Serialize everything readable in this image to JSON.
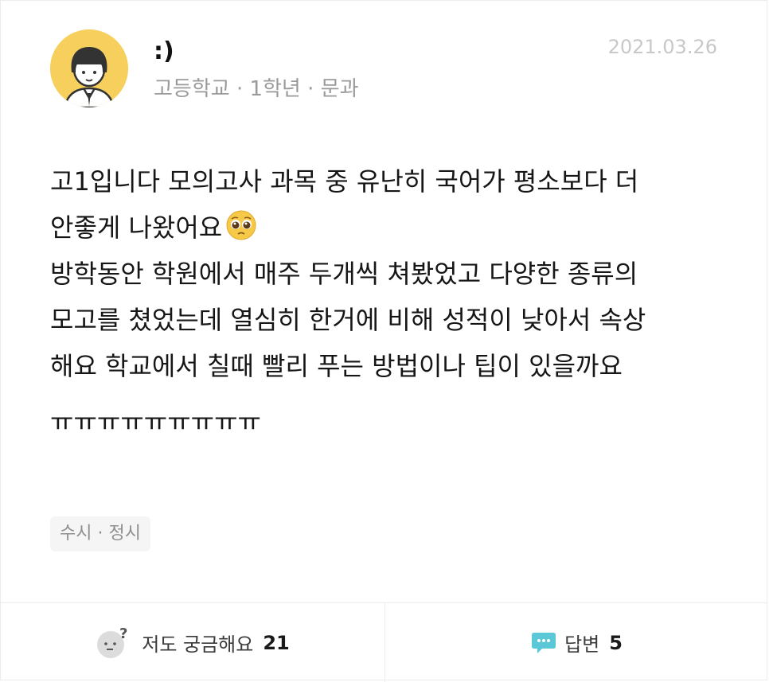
{
  "author": {
    "name": ":)",
    "school": "고등학교",
    "grade": "1학년",
    "track": "문과",
    "info": "고등학교 · 1학년 · 문과"
  },
  "post": {
    "date": "2021.03.26",
    "line1": "고1입니다 모의고사 과목 중 유난히 국어가 평소보다 더",
    "line2": "안좋게 나왔어요",
    "line2_emoji": "pleading-face-emoji",
    "line3": "방학동안 학원에서 매주 두개씩 쳐봤었고 다양한 종류의",
    "line4": "모고를 쳤었는데 열심히 한거에 비해 성적이 낮아서 속상",
    "line5": "해요 학교에서 칠때 빨리 푸는 방법이나 팁이 있을까요",
    "line6": "ㅠㅠㅠㅠㅠㅠㅠㅠㅠ"
  },
  "tag": "수시 · 정시",
  "footer": {
    "curious_label": "저도 궁금해요",
    "curious_count": "21",
    "answer_label": "답변",
    "answer_count": "5"
  },
  "colors": {
    "avatar_bg": "#f6cf5c",
    "answer_icon": "#5bc8d8",
    "date": "#c8c8c8"
  }
}
